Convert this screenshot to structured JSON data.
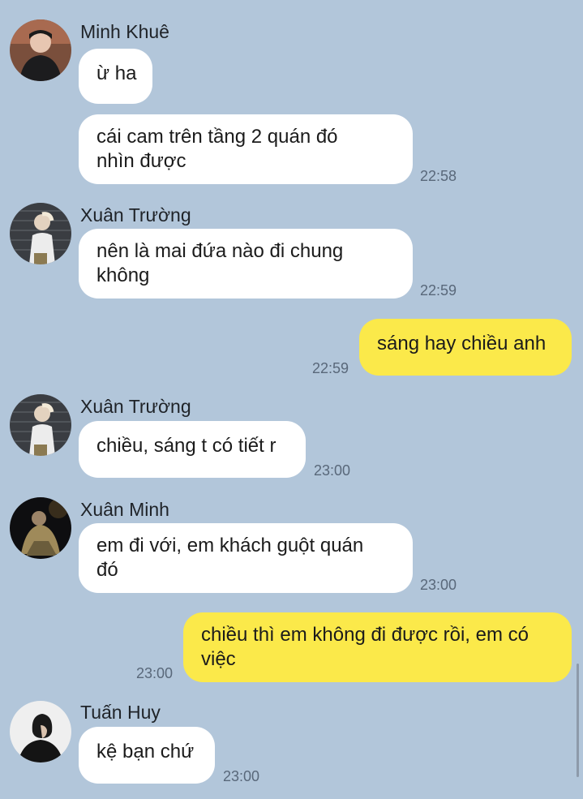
{
  "messages": [
    {
      "sender": "Minh Khuê",
      "text": "ừ ha",
      "time": ""
    },
    {
      "sender": "Minh Khuê",
      "text_lines": [
        "cái cam trên tầng 2 quán đó",
        "nhìn được"
      ],
      "time": "22:58"
    },
    {
      "sender": "Xuân Trường",
      "text_lines": [
        "nên là mai đứa nào đi chung",
        "không"
      ],
      "time": "22:59"
    },
    {
      "sender": "me",
      "text": "sáng hay chiều anh",
      "time": "22:59"
    },
    {
      "sender": "Xuân Trường",
      "text": "chiều, sáng t có tiết r",
      "time": "23:00"
    },
    {
      "sender": "Xuân Minh",
      "text_lines": [
        "em đi với, em khách guột quán",
        "đó"
      ],
      "time": "23:00"
    },
    {
      "sender": "me",
      "text_lines": [
        "chiều thì em không đi được rồi, em có",
        "việc"
      ],
      "time": "23:00"
    },
    {
      "sender": "Tuấn Huy",
      "text": "kệ bạn chứ",
      "time": "23:00"
    }
  ],
  "colors": {
    "background": "#b2c6da",
    "my_bubble": "#fbe94a",
    "their_bubble": "#ffffff"
  }
}
